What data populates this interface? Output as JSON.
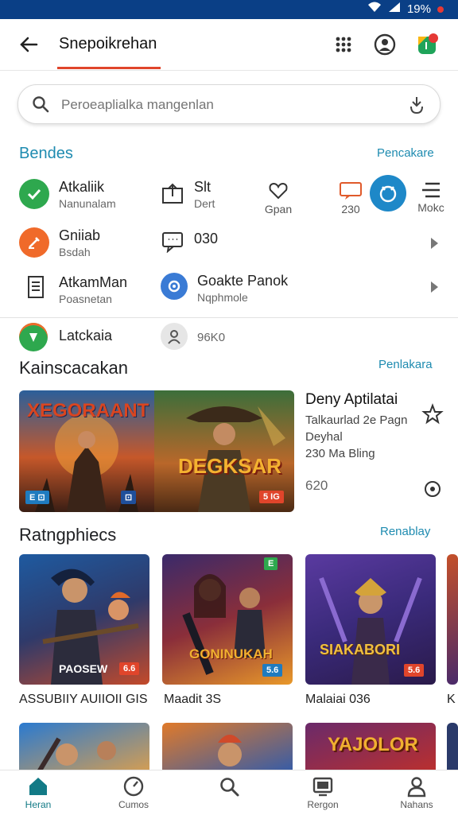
{
  "status": {
    "battery": "19%"
  },
  "appbar": {
    "title": "Snepoikrehan"
  },
  "search": {
    "placeholder": "Peroeaplialka mangenlan"
  },
  "section1": {
    "title": "Bendes",
    "link": "Pencakare",
    "row1": [
      {
        "main": "Atkaliik",
        "sub": "Nanunalam"
      },
      {
        "main": "Slt",
        "sub": "Dert"
      },
      {
        "label": "Gpan"
      },
      {
        "label": "230"
      },
      {
        "label": "Mokc"
      }
    ],
    "row2": [
      {
        "main": "Gniiab",
        "sub": "Bsdah"
      },
      {
        "main": "030"
      }
    ],
    "row3": [
      {
        "main": "AtkamMan",
        "sub": "Poasnetan"
      },
      {
        "main": "Goakte Panok",
        "sub": "Nqphmole"
      }
    ],
    "row4": [
      {
        "main": "Latckaia"
      },
      {
        "main": "96K0"
      }
    ]
  },
  "featured": {
    "title": "Kainscacakan",
    "link": "Penlakara",
    "banner_left_text": "XEGORAANT",
    "banner_right_text": "DEGKSAR",
    "badge_left": "E ⊡",
    "badge_right": "5 IG",
    "info_title": "Deny Aptilatai",
    "info_line1": "Talkaurlad 2e Pagn",
    "info_line2": "Deyhal",
    "info_line3": "230 Ma Bling",
    "info_count": "620"
  },
  "ratings": {
    "title": "Ratngphiecs",
    "link": "Renablay",
    "tiles": [
      {
        "art": "PAOSEW",
        "badge": "6.6",
        "caption": "ASSUBIIY AUIIOII GIS"
      },
      {
        "art": "GONINUKAH",
        "badge": "5.6",
        "caption": "Maadit 3S"
      },
      {
        "art": "SIAKABORI",
        "badge": "5.6",
        "caption": "Malaiai 036"
      },
      {
        "caption": "K"
      }
    ],
    "row2_tiles": [
      {
        "art": ""
      },
      {
        "art": ""
      },
      {
        "art": "YAJOLOR"
      }
    ]
  },
  "bottomnav": [
    {
      "label": "Heran",
      "active": true
    },
    {
      "label": "Cumos"
    },
    {
      "label": ""
    },
    {
      "label": "Rergon"
    },
    {
      "label": "Nahans"
    }
  ],
  "colors": {
    "accent": "#1e8bb0",
    "statusbar": "#0a3f86",
    "tab_underline": "#e0452b"
  }
}
